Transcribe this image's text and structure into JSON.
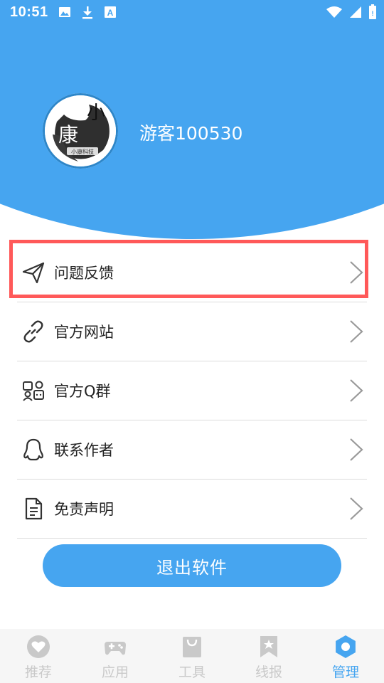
{
  "status_bar": {
    "time": "10:51"
  },
  "profile": {
    "username": "游客100530",
    "avatar_text_1": "小",
    "avatar_text_2": "康",
    "avatar_caption": "小康科技"
  },
  "menu": {
    "items": [
      {
        "label": "问题反馈",
        "icon": "paper-plane-icon"
      },
      {
        "label": "官方网站",
        "icon": "link-icon"
      },
      {
        "label": "官方Q群",
        "icon": "group-icon"
      },
      {
        "label": "联系作者",
        "icon": "qq-icon"
      },
      {
        "label": "免责声明",
        "icon": "document-icon"
      }
    ]
  },
  "logout_label": "退出软件",
  "tabs": [
    {
      "label": "推荐",
      "icon": "heart-icon"
    },
    {
      "label": "应用",
      "icon": "gamepad-icon"
    },
    {
      "label": "工具",
      "icon": "bag-icon"
    },
    {
      "label": "线报",
      "icon": "bookmark-icon"
    },
    {
      "label": "管理",
      "icon": "gear-icon"
    }
  ],
  "colors": {
    "primary": "#46a5f0",
    "highlight": "#ff5959",
    "inactive": "#c9c9c9"
  }
}
